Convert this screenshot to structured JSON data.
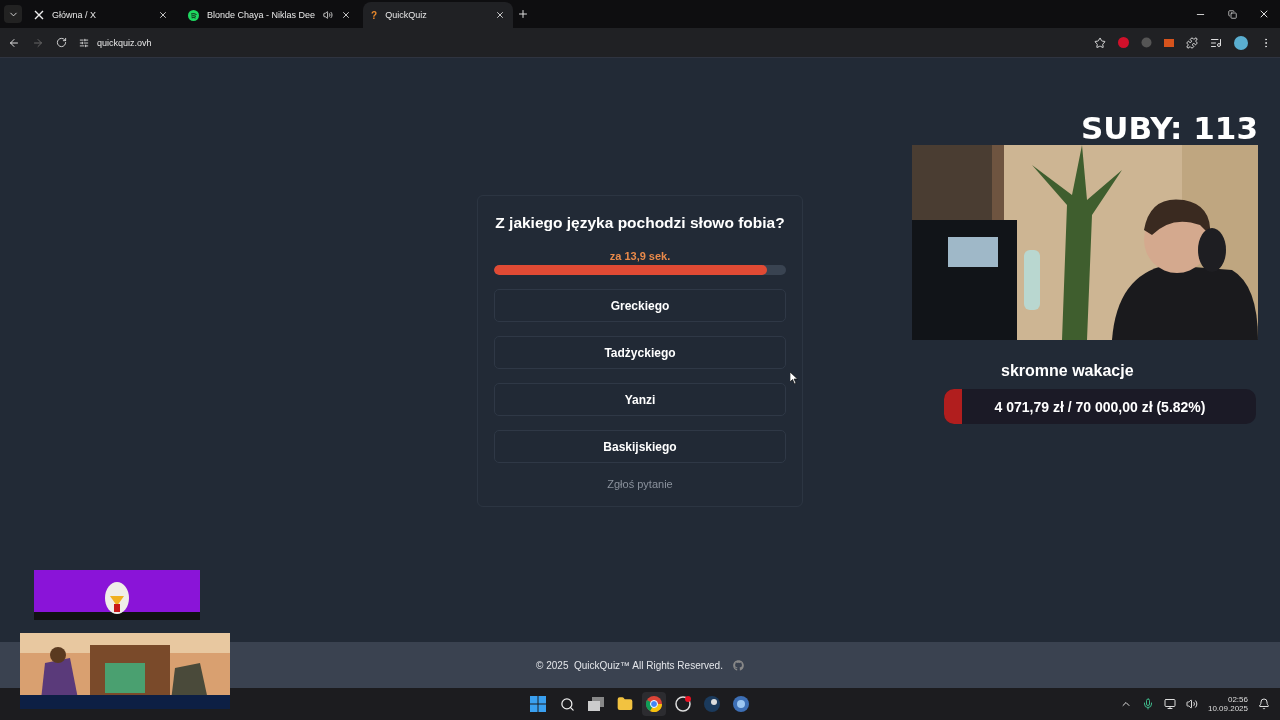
{
  "browser": {
    "tabs": [
      {
        "kind": "x",
        "title": "Główna / X",
        "selected": false
      },
      {
        "kind": "music",
        "title": "Blonde Chaya - Niklas Dee",
        "selected": false,
        "audio": true
      },
      {
        "kind": "quiz",
        "title": "QuickQuiz",
        "favicon": "?",
        "selected": true
      }
    ],
    "address": "quickquiz.ovh"
  },
  "quiz": {
    "question": "Z jakiego języka pochodzi słowo fobia?",
    "timer": "za 13,9 sek.",
    "level": 0.935,
    "answers": [
      "Greckiego",
      "Tadżyckiego",
      "Yanzi",
      "Baskijskiego"
    ],
    "report_link": "Zgłoś pytanie"
  },
  "footer": {
    "text": "© 2025  QuickQuiz™ All Rights Reserved."
  },
  "overlay": {
    "subs": "SUBY: 113",
    "goal_title": "skromne wakacje",
    "goal_text": "4 071,79 zł / 70 000,00 zł (5.82%)",
    "level": 0.0582
  },
  "taskbar": {
    "time": "02:56",
    "date": "10.09.2025"
  }
}
